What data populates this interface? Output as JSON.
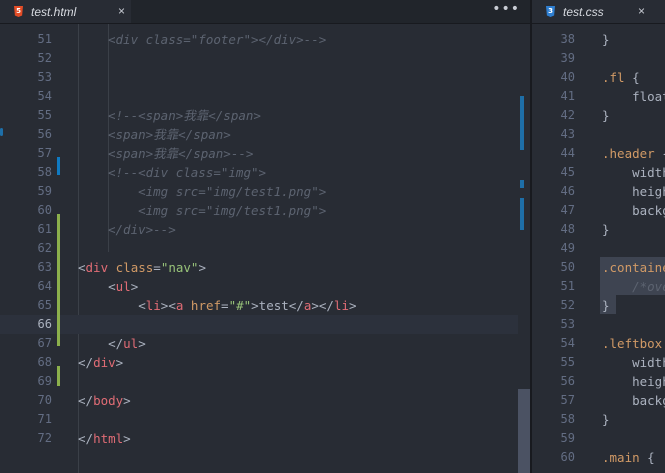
{
  "left_tab": {
    "title": "test.html",
    "icon_text": "5",
    "close_label": "×",
    "more_label": "•••"
  },
  "right_tab": {
    "title": "test.css",
    "icon_text": "3",
    "close_label": "×"
  },
  "colors": {
    "html_icon": "#e34c26",
    "css_icon": "#2f7fd1"
  },
  "left_lines": [
    {
      "n": "51",
      "cur": false,
      "t": [
        [
          "cmt",
          "<div class=\"footer\"></div>-->"
        ]
      ]
    },
    {
      "n": "52",
      "cur": false,
      "t": []
    },
    {
      "n": "53",
      "cur": false,
      "t": []
    },
    {
      "n": "54",
      "cur": false,
      "t": []
    },
    {
      "n": "55",
      "cur": false,
      "t": [
        [
          "cmt",
          "<!--<span>我靠</span>"
        ]
      ]
    },
    {
      "n": "56",
      "cur": false,
      "t": [
        [
          "cmt",
          "<span>我靠</span>"
        ]
      ]
    },
    {
      "n": "57",
      "cur": false,
      "t": [
        [
          "cmt",
          "<span>我靠</span>-->"
        ]
      ]
    },
    {
      "n": "58",
      "cur": false,
      "t": [
        [
          "cmt",
          "<!--<div class=\"img\">"
        ]
      ]
    },
    {
      "n": "59",
      "cur": false,
      "t": [
        [
          "cmt",
          "    <img src=\"img/test1.png\">"
        ]
      ]
    },
    {
      "n": "60",
      "cur": false,
      "t": [
        [
          "cmt",
          "    <img src=\"img/test1.png\">"
        ]
      ]
    },
    {
      "n": "61",
      "cur": false,
      "t": [
        [
          "cmt",
          "</div>-->"
        ]
      ]
    },
    {
      "n": "62",
      "cur": false,
      "t": []
    },
    {
      "n": "63",
      "cur": false,
      "t": [
        [
          "p",
          "<"
        ],
        [
          "tag",
          "div"
        ],
        [
          "p",
          " "
        ],
        [
          "attr",
          "class"
        ],
        [
          "p",
          "="
        ],
        [
          "str",
          "\"nav\""
        ],
        [
          "p",
          ">"
        ]
      ]
    },
    {
      "n": "64",
      "cur": false,
      "t": [
        [
          "p",
          "    <"
        ],
        [
          "tag",
          "ul"
        ],
        [
          "p",
          ">"
        ]
      ]
    },
    {
      "n": "65",
      "cur": false,
      "t": [
        [
          "p",
          "        <"
        ],
        [
          "tag",
          "li"
        ],
        [
          "p",
          "><"
        ],
        [
          "tag",
          "a"
        ],
        [
          "p",
          " "
        ],
        [
          "attr",
          "href"
        ],
        [
          "p",
          "="
        ],
        [
          "str",
          "\"#\""
        ],
        [
          "p",
          ">test</"
        ],
        [
          "tag",
          "a"
        ],
        [
          "p",
          "></"
        ],
        [
          "tag",
          "li"
        ],
        [
          "p",
          ">"
        ]
      ]
    },
    {
      "n": "66",
      "cur": true,
      "t": []
    },
    {
      "n": "67",
      "cur": false,
      "t": [
        [
          "p",
          "    </"
        ],
        [
          "tag",
          "ul"
        ],
        [
          "p",
          ">"
        ]
      ]
    },
    {
      "n": "68",
      "cur": false,
      "t": [
        [
          "p",
          "</"
        ],
        [
          "tag",
          "div"
        ],
        [
          "p",
          ">"
        ]
      ]
    },
    {
      "n": "69",
      "cur": false,
      "t": []
    },
    {
      "n": "70",
      "cur": false,
      "t": [
        [
          "p",
          "</"
        ],
        [
          "tag",
          "body"
        ],
        [
          "p",
          ">"
        ]
      ]
    },
    {
      "n": "71",
      "cur": false,
      "t": []
    },
    {
      "n": "72",
      "cur": false,
      "t": [
        [
          "p",
          "</"
        ],
        [
          "tag",
          "html"
        ],
        [
          "p",
          ">"
        ]
      ]
    }
  ],
  "right_lines": [
    {
      "n": "38",
      "t": [
        [
          "p",
          "}"
        ]
      ]
    },
    {
      "n": "39",
      "t": []
    },
    {
      "n": "40",
      "t": [
        [
          "sel",
          ".fl"
        ],
        [
          "p",
          " {"
        ]
      ]
    },
    {
      "n": "41",
      "t": [
        [
          "p",
          "    float"
        ]
      ]
    },
    {
      "n": "42",
      "t": [
        [
          "p",
          "}"
        ]
      ]
    },
    {
      "n": "43",
      "t": []
    },
    {
      "n": "44",
      "t": [
        [
          "sel",
          ".header"
        ],
        [
          "p",
          " {"
        ]
      ]
    },
    {
      "n": "45",
      "t": [
        [
          "p",
          "    width"
        ]
      ]
    },
    {
      "n": "46",
      "t": [
        [
          "p",
          "    heigh"
        ]
      ]
    },
    {
      "n": "47",
      "t": [
        [
          "p",
          "    backg"
        ]
      ]
    },
    {
      "n": "48",
      "t": [
        [
          "p",
          "}"
        ]
      ]
    },
    {
      "n": "49",
      "t": []
    },
    {
      "n": "50",
      "t": [
        [
          "sel",
          ".containe"
        ]
      ]
    },
    {
      "n": "51",
      "t": [
        [
          "cmt",
          "    /*ove"
        ]
      ]
    },
    {
      "n": "52",
      "t": [
        [
          "p",
          "}"
        ]
      ]
    },
    {
      "n": "53",
      "t": []
    },
    {
      "n": "54",
      "t": [
        [
          "sel",
          ".leftbox"
        ]
      ]
    },
    {
      "n": "55",
      "t": [
        [
          "p",
          "    width"
        ]
      ]
    },
    {
      "n": "56",
      "t": [
        [
          "p",
          "    heigh"
        ]
      ]
    },
    {
      "n": "57",
      "t": [
        [
          "p",
          "    backg"
        ]
      ]
    },
    {
      "n": "58",
      "t": [
        [
          "p",
          "}"
        ]
      ]
    },
    {
      "n": "59",
      "t": []
    },
    {
      "n": "60",
      "t": [
        [
          "sel",
          ".main"
        ],
        [
          "p",
          " {"
        ]
      ]
    }
  ]
}
